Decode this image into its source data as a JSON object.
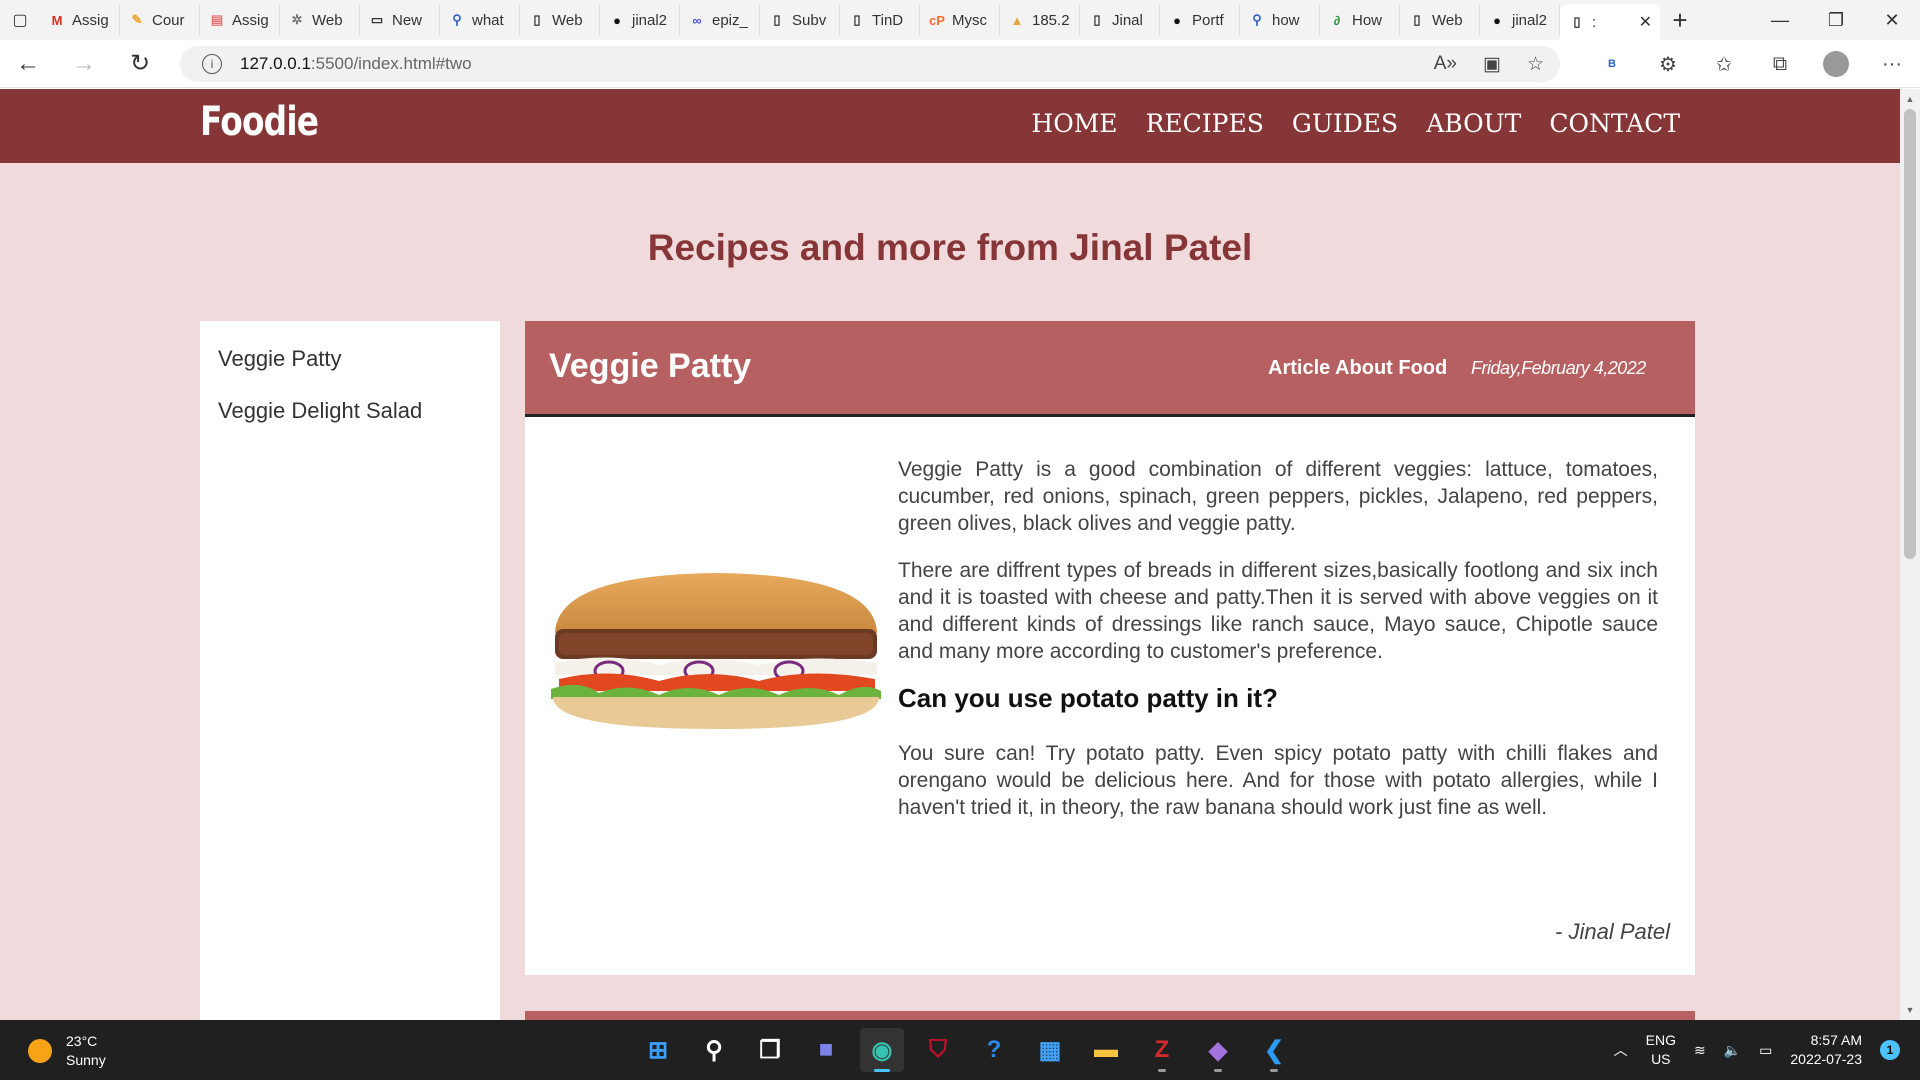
{
  "browser": {
    "tabs": [
      {
        "title": "Assig",
        "icon": "gmail-icon",
        "glyph": "M",
        "color": "#d93025"
      },
      {
        "title": "Cour",
        "icon": "course-icon",
        "glyph": "✎",
        "color": "#f4a62a"
      },
      {
        "title": "Assig",
        "icon": "pdf-icon",
        "glyph": "▤",
        "color": "#e57373"
      },
      {
        "title": "Web",
        "icon": "settings-icon",
        "glyph": "✲",
        "color": "#777777"
      },
      {
        "title": "New",
        "icon": "newtab-icon",
        "glyph": "▭",
        "color": "#333333"
      },
      {
        "title": "what",
        "icon": "search-icon",
        "glyph": "⚲",
        "color": "#2b5fc7"
      },
      {
        "title": "Web",
        "icon": "page-icon",
        "glyph": "▯",
        "color": "#333333"
      },
      {
        "title": "jinal2",
        "icon": "github-icon",
        "glyph": "●",
        "color": "#111111"
      },
      {
        "title": "epiz_",
        "icon": "infinity-icon",
        "glyph": "∞",
        "color": "#4a4ad8"
      },
      {
        "title": "Subv",
        "icon": "page-icon",
        "glyph": "▯",
        "color": "#333333"
      },
      {
        "title": "TinD",
        "icon": "page-icon",
        "glyph": "▯",
        "color": "#333333"
      },
      {
        "title": "Mysc",
        "icon": "cpanel-icon",
        "glyph": "cP",
        "color": "#ff6c2c"
      },
      {
        "title": "185.2",
        "icon": "phpmyadmin-icon",
        "glyph": "▲",
        "color": "#e8a33d"
      },
      {
        "title": "Jinal",
        "icon": "page-icon",
        "glyph": "▯",
        "color": "#333333"
      },
      {
        "title": "Portf",
        "icon": "github-icon",
        "glyph": "●",
        "color": "#111111"
      },
      {
        "title": "how",
        "icon": "search-icon",
        "glyph": "⚲",
        "color": "#2b5fc7"
      },
      {
        "title": "How",
        "icon": "geeks-icon",
        "glyph": "∂",
        "color": "#2f8d46"
      },
      {
        "title": "Web",
        "icon": "page-icon",
        "glyph": "▯",
        "color": "#333333"
      },
      {
        "title": "jinal2",
        "icon": "github-icon",
        "glyph": "●",
        "color": "#111111"
      }
    ],
    "active_tab": {
      "title": ":",
      "icon": "page-icon"
    },
    "url_host": "127.0.0.1",
    "url_rest": ":5500/index.html#two"
  },
  "site": {
    "logo": "Foodie",
    "nav": [
      "HOME",
      "RECIPES",
      "GUIDES",
      "ABOUT",
      "CONTACT"
    ],
    "page_title": "Recipes and more from Jinal Patel",
    "sidebar": [
      "Veggie Patty",
      "Veggie Delight Salad"
    ],
    "article": {
      "title": "Veggie Patty",
      "tag": "Article About Food",
      "date": "Friday,February 4,2022",
      "p1": "Veggie Patty is a good combination of different veggies: lattuce, tomatoes, cucumber, red onions, spinach, green peppers, pickles, Jalapeno, red peppers, green olives, black olives and veggie patty.",
      "p2": "There are diffrent types of breads in different sizes,basically footlong and six inch and it is toasted with cheese and patty.Then it is served with above veggies on it and different kinds of dressings like ranch sauce, Mayo sauce, Chipotle sauce and many more according to customer's preference.",
      "subheading": "Can you use potato patty in it?",
      "p3": "You sure can! Try potato patty. Even spicy potato patty with chilli flakes and orengano would be delicious here. And for those with potato allergies, while I haven't tried it, in theory, the raw banana should work just fine as well.",
      "signature": "- Jinal Patel"
    },
    "colors": {
      "header": "#873638",
      "article_head": "#b76061",
      "background": "#f0dadc"
    }
  },
  "taskbar": {
    "temperature": "23°C",
    "weather": "Sunny",
    "lang_top": "ENG",
    "lang_bottom": "US",
    "time": "8:57 AM",
    "date": "2022-07-23",
    "notifications": "1"
  }
}
